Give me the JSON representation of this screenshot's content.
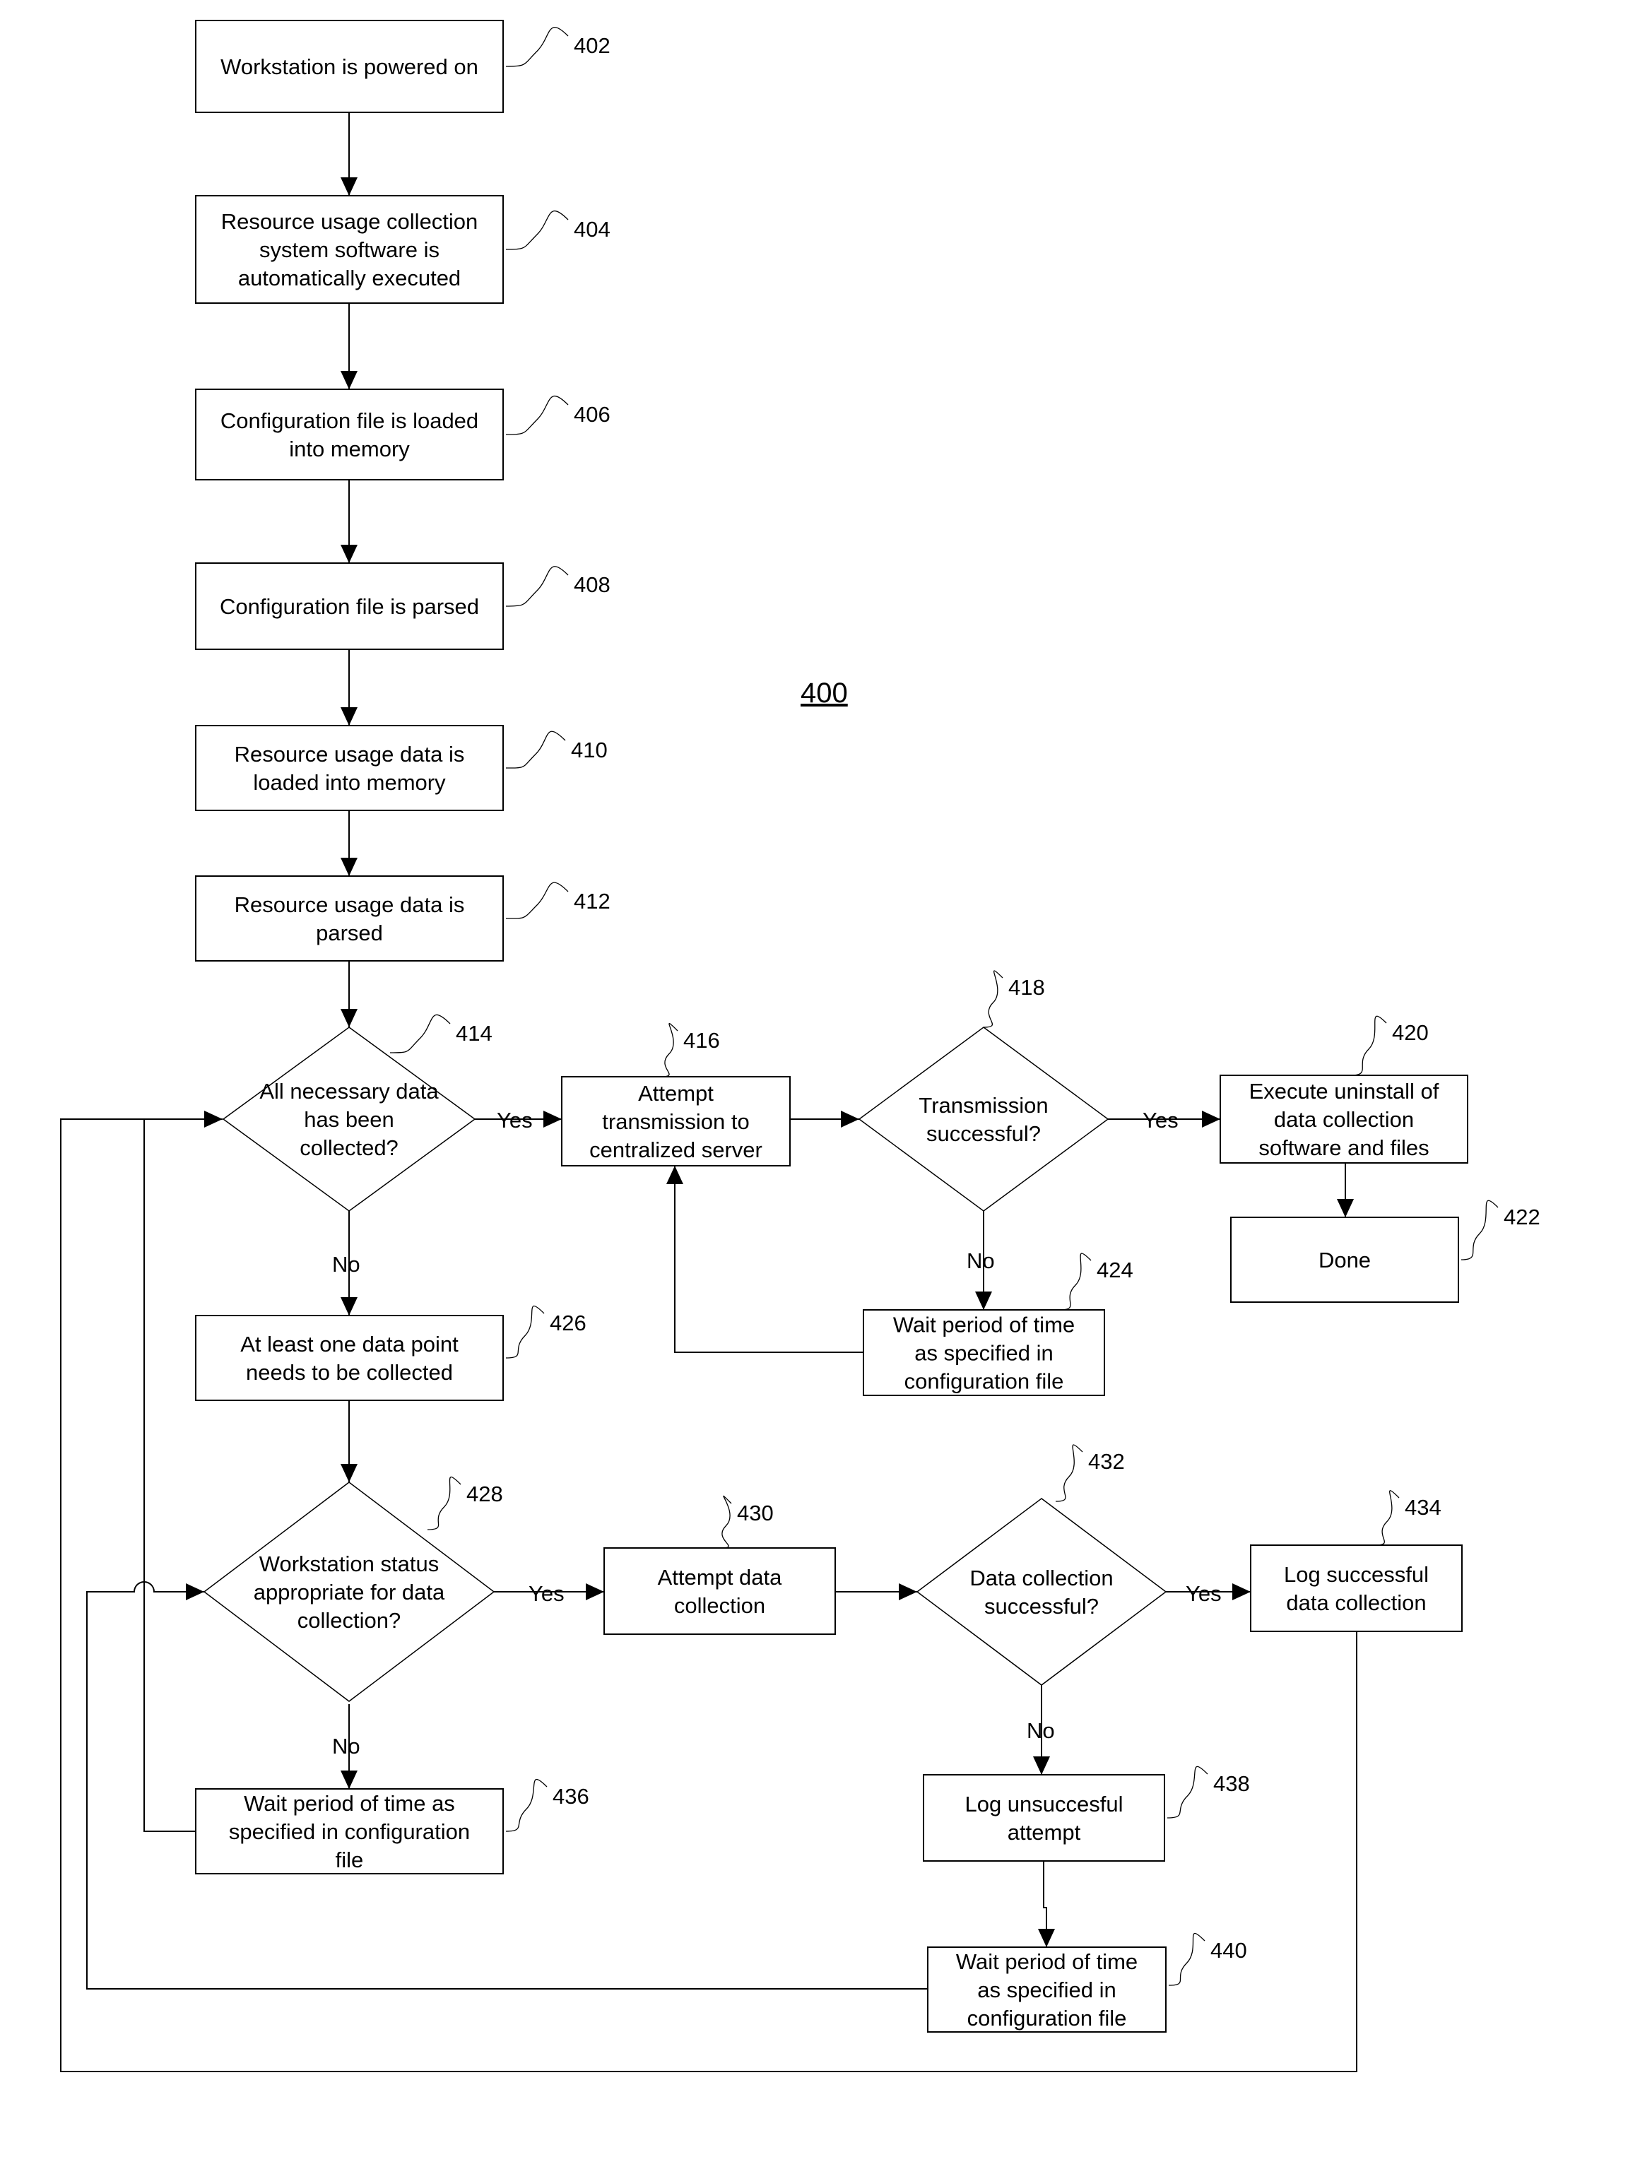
{
  "figure": {
    "number": "400"
  },
  "nodes": [
    {
      "id": "402",
      "type": "process",
      "ref": "402",
      "lines": [
        "Workstation is powered on"
      ]
    },
    {
      "id": "404",
      "type": "process",
      "ref": "404",
      "lines": [
        "Resource usage collection",
        "system software is",
        "automatically executed"
      ]
    },
    {
      "id": "406",
      "type": "process",
      "ref": "406",
      "lines": [
        "Configuration file is loaded",
        "into memory"
      ]
    },
    {
      "id": "408",
      "type": "process",
      "ref": "408",
      "lines": [
        "Configuration file is parsed"
      ]
    },
    {
      "id": "410",
      "type": "process",
      "ref": "410",
      "lines": [
        "Resource usage data is",
        "loaded into memory"
      ]
    },
    {
      "id": "412",
      "type": "process",
      "ref": "412",
      "lines": [
        "Resource usage data is",
        "parsed"
      ]
    },
    {
      "id": "414",
      "type": "decision",
      "ref": "414",
      "lines": [
        "All necessary data",
        "has been",
        "collected?"
      ]
    },
    {
      "id": "416",
      "type": "process",
      "ref": "416",
      "lines": [
        "Attempt",
        "transmission to",
        "centralized server"
      ]
    },
    {
      "id": "418",
      "type": "decision",
      "ref": "418",
      "lines": [
        "Transmission",
        "successful?"
      ]
    },
    {
      "id": "420",
      "type": "process",
      "ref": "420",
      "lines": [
        "Execute uninstall of",
        "data collection",
        "software and files"
      ]
    },
    {
      "id": "422",
      "type": "process",
      "ref": "422",
      "lines": [
        "Done"
      ]
    },
    {
      "id": "424",
      "type": "process",
      "ref": "424",
      "lines": [
        "Wait period of time",
        "as specified in",
        "configuration file"
      ]
    },
    {
      "id": "426",
      "type": "process",
      "ref": "426",
      "lines": [
        "At least one data point",
        "needs to be collected"
      ]
    },
    {
      "id": "428",
      "type": "decision",
      "ref": "428",
      "lines": [
        "Workstation status",
        "appropriate for data",
        "collection?"
      ]
    },
    {
      "id": "430",
      "type": "process",
      "ref": "430",
      "lines": [
        "Attempt data",
        "collection"
      ]
    },
    {
      "id": "432",
      "type": "decision",
      "ref": "432",
      "lines": [
        "Data collection",
        "successful?"
      ]
    },
    {
      "id": "434",
      "type": "process",
      "ref": "434",
      "lines": [
        "Log successful",
        "data collection"
      ]
    },
    {
      "id": "436",
      "type": "process",
      "ref": "436",
      "lines": [
        "Wait period of time as",
        "specified in configuration",
        "file"
      ]
    },
    {
      "id": "438",
      "type": "process",
      "ref": "438",
      "lines": [
        "Log unsuccesful",
        "attempt"
      ]
    },
    {
      "id": "440",
      "type": "process",
      "ref": "440",
      "lines": [
        "Wait period of time",
        "as specified in",
        "configuration file"
      ]
    }
  ],
  "edges": [
    {
      "from": "402",
      "to": "404",
      "label": ""
    },
    {
      "from": "404",
      "to": "406",
      "label": ""
    },
    {
      "from": "406",
      "to": "408",
      "label": ""
    },
    {
      "from": "408",
      "to": "410",
      "label": ""
    },
    {
      "from": "410",
      "to": "412",
      "label": ""
    },
    {
      "from": "412",
      "to": "414",
      "label": ""
    },
    {
      "from": "414",
      "to": "416",
      "label": "Yes"
    },
    {
      "from": "414",
      "to": "426",
      "label": "No"
    },
    {
      "from": "416",
      "to": "418",
      "label": ""
    },
    {
      "from": "418",
      "to": "420",
      "label": "Yes"
    },
    {
      "from": "418",
      "to": "424",
      "label": "No"
    },
    {
      "from": "424",
      "to": "416",
      "label": ""
    },
    {
      "from": "420",
      "to": "422",
      "label": ""
    },
    {
      "from": "426",
      "to": "428",
      "label": ""
    },
    {
      "from": "428",
      "to": "430",
      "label": "Yes"
    },
    {
      "from": "428",
      "to": "436",
      "label": "No"
    },
    {
      "from": "430",
      "to": "432",
      "label": ""
    },
    {
      "from": "432",
      "to": "434",
      "label": "Yes"
    },
    {
      "from": "432",
      "to": "438",
      "label": "No"
    },
    {
      "from": "438",
      "to": "440",
      "label": ""
    },
    {
      "from": "436",
      "to": "414",
      "label": ""
    },
    {
      "from": "440",
      "to": "428",
      "label": ""
    },
    {
      "from": "434",
      "to": "414",
      "label": ""
    }
  ],
  "labels": {
    "yes": "Yes",
    "no": "No"
  }
}
